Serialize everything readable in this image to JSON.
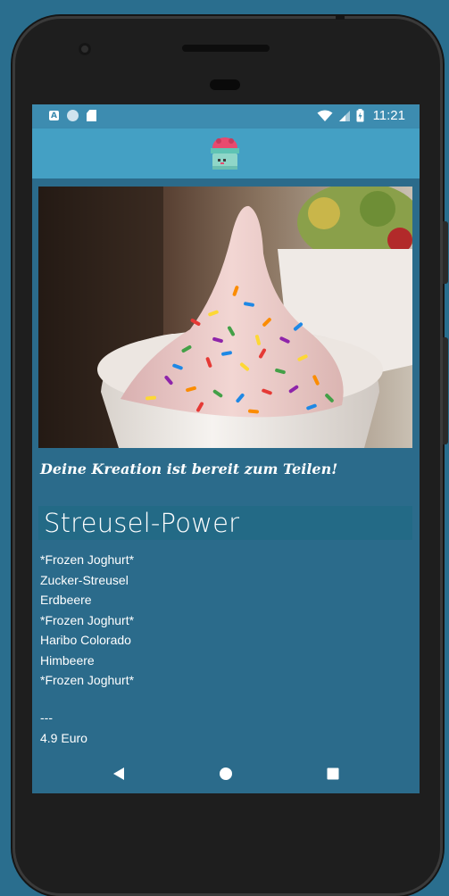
{
  "status_bar": {
    "time": "11:21",
    "left_icons": [
      "notification-a-icon",
      "circle-icon",
      "sd-card-icon"
    ],
    "right_icons": [
      "wifi-icon",
      "cell-signal-icon",
      "battery-charging-icon"
    ]
  },
  "app_bar": {
    "logo": "cupcake-logo-icon"
  },
  "main": {
    "hero_image": "frozen-yogurt-with-sprinkles-photo",
    "share_message": "Deine Kreation ist bereit zum Teilen!",
    "creation_title": "Streusel-Power",
    "ingredients": [
      "*Frozen Joghurt*",
      "Zucker-Streusel",
      "Erdbeere",
      "*Frozen Joghurt*",
      "Haribo Colorado",
      "Himbeere",
      "*Frozen Joghurt*"
    ],
    "separator": "---",
    "price": "4.9 Euro"
  },
  "nav_bar": {
    "back": "back-icon",
    "home": "home-icon",
    "recents": "recents-icon"
  },
  "colors": {
    "background": "#2a6e8e",
    "status_bar": "#3d8cb0",
    "app_bar": "#44a0c4",
    "screen": "#2b6b8b",
    "title_box": "#236a86",
    "text": "#ffffff"
  }
}
